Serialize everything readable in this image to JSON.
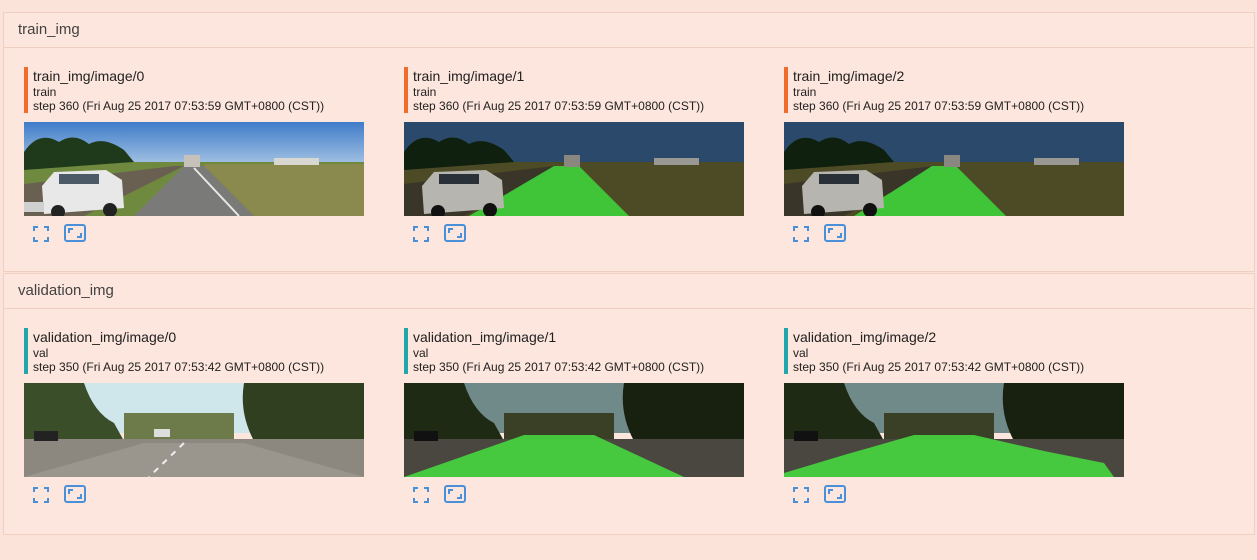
{
  "sections": [
    {
      "title": "train_img",
      "accent": "#f06c2c",
      "cards": [
        {
          "title": "train_img/image/0",
          "run": "train",
          "step": "step 360 (Fri Aug 25 2017 07:53:59 GMT+0800 (CST))",
          "overlay": false
        },
        {
          "title": "train_img/image/1",
          "run": "train",
          "step": "step 360 (Fri Aug 25 2017 07:53:59 GMT+0800 (CST))",
          "overlay": true
        },
        {
          "title": "train_img/image/2",
          "run": "train",
          "step": "step 360 (Fri Aug 25 2017 07:53:59 GMT+0800 (CST))",
          "overlay": true
        }
      ]
    },
    {
      "title": "validation_img",
      "accent": "#1fa7ac",
      "cards": [
        {
          "title": "validation_img/image/0",
          "run": "val",
          "step": "step 350 (Fri Aug 25 2017 07:53:42 GMT+0800 (CST))",
          "overlay": false
        },
        {
          "title": "validation_img/image/1",
          "run": "val",
          "step": "step 350 (Fri Aug 25 2017 07:53:42 GMT+0800 (CST))",
          "overlay": true
        },
        {
          "title": "validation_img/image/2",
          "run": "val",
          "step": "step 350 (Fri Aug 25 2017 07:53:42 GMT+0800 (CST))",
          "overlay": true
        }
      ]
    }
  ],
  "icons": {
    "fullscreen": "fullscreen-icon",
    "actual_size": "actual-size-icon",
    "color": "#4a90d9"
  }
}
